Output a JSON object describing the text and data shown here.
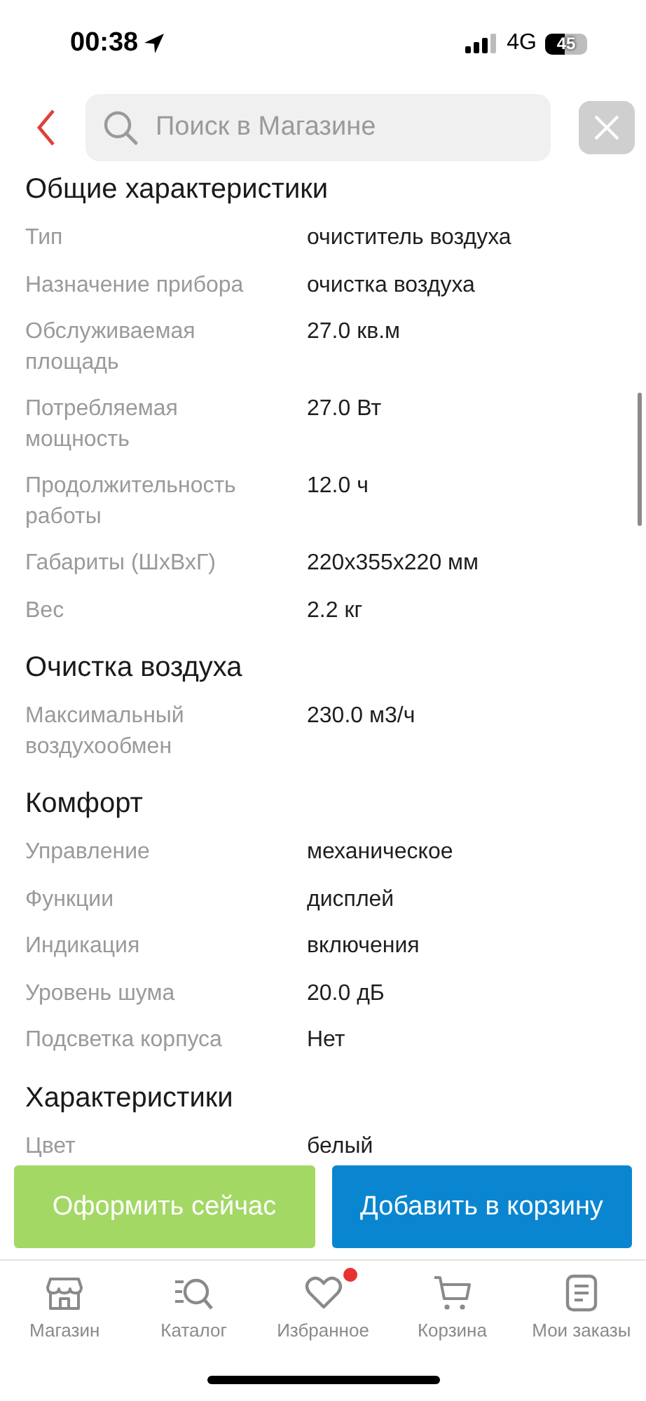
{
  "status_bar": {
    "time": "00:38",
    "network": "4G",
    "battery": "45"
  },
  "search": {
    "placeholder": "Поиск в Магазине"
  },
  "sections": [
    {
      "title": "Общие характеристики",
      "rows": [
        {
          "label": "Тип",
          "value": "очиститель воздуха"
        },
        {
          "label": "Назначение прибора",
          "value": "очистка воздуха"
        },
        {
          "label": "Обслуживаемая площадь",
          "value": "27.0 кв.м"
        },
        {
          "label": "Потребляемая мощность",
          "value": "27.0 Вт"
        },
        {
          "label": "Продолжительность работы",
          "value": "12.0 ч"
        },
        {
          "label": "Габариты (ШхВхГ)",
          "value": "220x355x220 мм"
        },
        {
          "label": "Вес",
          "value": "2.2 кг"
        }
      ]
    },
    {
      "title": "Очистка воздуха",
      "rows": [
        {
          "label": "Максимальный воздухообмен",
          "value": "230.0 м3/ч"
        }
      ]
    },
    {
      "title": "Комфорт",
      "rows": [
        {
          "label": "Управление",
          "value": "механическое"
        },
        {
          "label": "Функции",
          "value": "дисплей"
        },
        {
          "label": "Индикация",
          "value": "включения"
        },
        {
          "label": "Уровень шума",
          "value": "20.0 дБ"
        },
        {
          "label": "Подсветка корпуса",
          "value": "Нет"
        }
      ]
    },
    {
      "title": "Характеристики",
      "rows": [
        {
          "label": "Цвет",
          "value": "белый"
        }
      ]
    }
  ],
  "actions": [
    {
      "label": "Оформить сейчас",
      "kind": "buy"
    },
    {
      "label": "Добавить в корзину",
      "kind": "cart"
    }
  ],
  "nav": [
    {
      "label": "Магазин",
      "kind": "shop",
      "selected": false,
      "badge": false
    },
    {
      "label": "Каталог",
      "kind": "catalog",
      "selected": false,
      "badge": false
    },
    {
      "label": "Избранное",
      "kind": "heart",
      "selected": false,
      "badge": true
    },
    {
      "label": "Корзина",
      "kind": "cart",
      "selected": false,
      "badge": false
    },
    {
      "label": "Мои заказы",
      "kind": "orders",
      "selected": false,
      "badge": false
    }
  ]
}
